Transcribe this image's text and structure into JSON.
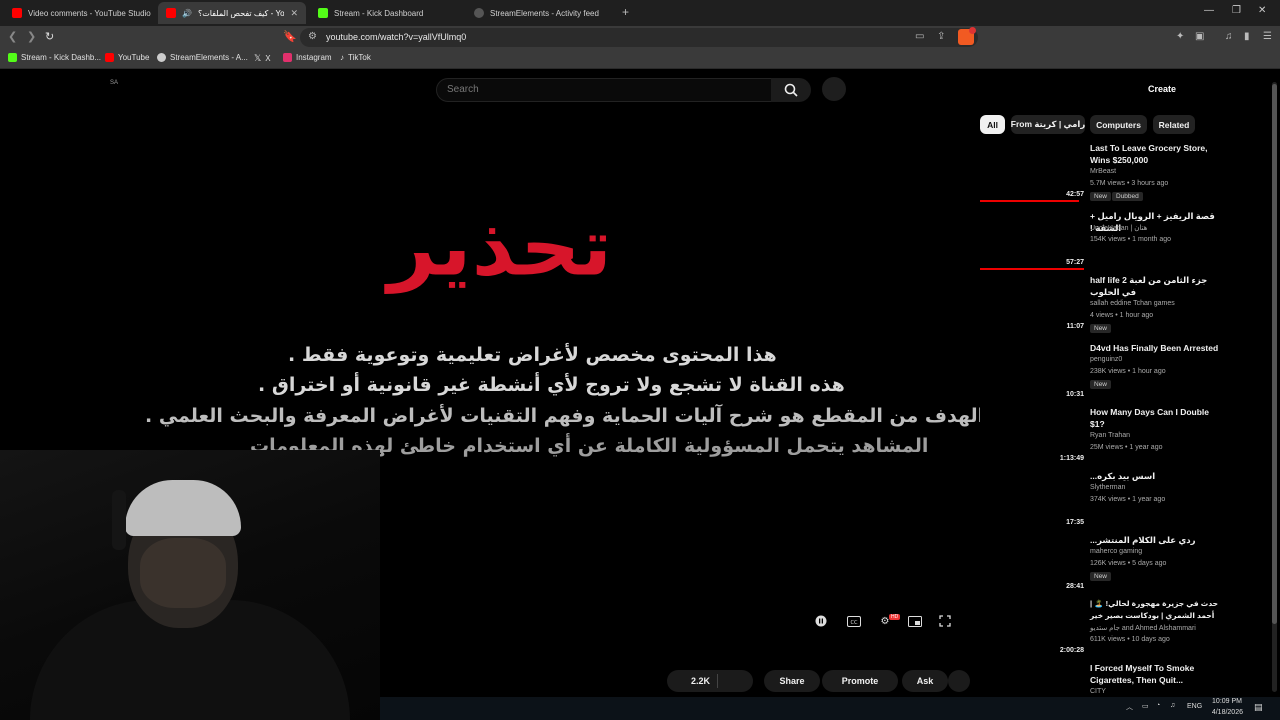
{
  "tabs": [
    {
      "title": "Video comments - YouTube Studio",
      "color": "#ff0000"
    },
    {
      "title": "كيف تفحص الملفات؟ - YouTube",
      "color": "#ff0000"
    },
    {
      "title": "Stream - Kick Dashboard",
      "color": "#53fc18"
    },
    {
      "title": "StreamElements - Activity feed",
      "color": "#aaaaaa"
    }
  ],
  "address": {
    "url": "youtube.com/watch?v=yallVfUlmq0"
  },
  "bookmarks": [
    {
      "label": "Stream - Kick Dashb...",
      "color": "#53fc18"
    },
    {
      "label": "YouTube",
      "color": "#ff0000"
    },
    {
      "label": "StreamElements - A...",
      "color": "#cccccc"
    },
    {
      "label": "X",
      "color": "#ffffff"
    },
    {
      "label": "Instagram",
      "color": "#e1306c"
    },
    {
      "label": "TikTok",
      "color": "#ffffff"
    }
  ],
  "page": {
    "sa_label": "SA",
    "search_placeholder": "Search",
    "create_label": "Create"
  },
  "video": {
    "warning_title": "تحذير",
    "lines": [
      "هذا المحتوى مخصص لأغراض تعليمية وتوعوية فقط .",
      "هذه القناة لا تشجع ولا تروج لأي أنشطة غير قانونية أو اختراق .",
      "الهدف من المقطع هو شرح آليات الحماية وفهم التقنيات لأغراض المعرفة والبحث العلمي .",
      "المشاهد يتحمل المسؤولية الكاملة عن أي استخدام خاطئ لهذه المعلومات"
    ]
  },
  "actions": {
    "likes": "2.2K",
    "share": "Share",
    "promote": "Promote",
    "ask": "Ask"
  },
  "chips": [
    "All",
    "From رامي | كريتة",
    "Computers",
    "Related"
  ],
  "recommendations": [
    {
      "title": "Last To Leave Grocery Store, Wins $250,000",
      "channel": "MrBeast",
      "meta": "5.7M views • 3 hours ago",
      "duration": "42:57",
      "badges": [
        "New",
        "Dubbed"
      ],
      "progress": 0.95
    },
    {
      "title": "قصة الريفيز + الرويال راميل + الشقة !",
      "channel": "UncleHattan | هتان",
      "meta": "154K views • 1 month ago",
      "duration": "57:27",
      "badges": [],
      "progress": 1.0
    },
    {
      "title": "جزء الثامن من لعبة half life 2 في الحلوب",
      "channel": "sallah eddine Tchan games",
      "meta": "4 views • 1 hour ago",
      "duration": "11:07",
      "badges": [
        "New"
      ],
      "progress": 0
    },
    {
      "title": "D4vd Has Finally Been Arrested",
      "channel": "penguinz0",
      "meta": "238K views • 1 hour ago",
      "duration": "10:31",
      "badges": [
        "New"
      ],
      "progress": 0
    },
    {
      "title": "How Many Days Can I Double $1?",
      "channel": "Ryan Trahan",
      "meta": "25M views • 1 year ago",
      "duration": "1:13:49",
      "badges": [],
      "progress": 0
    },
    {
      "title": "اسس بيد بكره...",
      "channel": "Slytherman",
      "meta": "374K views • 1 year ago",
      "duration": "17:35",
      "badges": [],
      "progress": 0
    },
    {
      "title": "ردي على الكلام المنتشر...",
      "channel": "maherco gaming",
      "meta": "126K views • 5 days ago",
      "duration": "28:41",
      "badges": [
        "New"
      ],
      "progress": 0
    },
    {
      "title": "حدث في جزيرة مهجورة لحالي! 🏝️ | أحمد الشمري | بودكاست بصير خير",
      "channel": "جام ستديو and Ahmed Alshammari",
      "meta": "611K views • 10 days ago",
      "duration": "2:00:28",
      "badges": [],
      "progress": 0
    },
    {
      "title": "I Forced Myself To Smoke Cigarettes, Then Quit...",
      "channel": "CITY",
      "meta": "",
      "duration": "",
      "badges": [],
      "progress": 0
    }
  ],
  "taskbar": {
    "lang": "ENG",
    "time": "10:09 PM",
    "date": "4/18/2026"
  }
}
